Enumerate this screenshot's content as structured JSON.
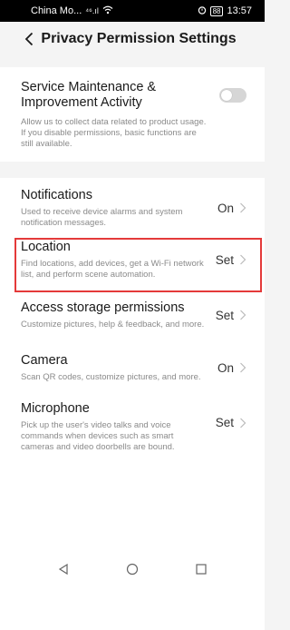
{
  "status_bar": {
    "carrier": "China Mo...",
    "signal_text": "⁴⁶.ıl",
    "time": "13:57",
    "battery": "88"
  },
  "header": {
    "title": "Privacy Permission Settings"
  },
  "service": {
    "title": "Service Maintenance & Improvement Activity",
    "desc": "Allow us to collect data related to product usage. If you disable permissions, basic functions are still available.",
    "toggle_state": "off"
  },
  "permissions": [
    {
      "title": "Notifications",
      "desc": "Used to receive device alarms and system notification messages.",
      "value": "On"
    },
    {
      "title": "Location",
      "desc": "Find locations, add devices, get a Wi-Fi network list, and perform scene automation.",
      "value": "Set"
    },
    {
      "title": "Access storage permissions",
      "desc": "Customize pictures, help & feedback, and more.",
      "value": "Set"
    },
    {
      "title": "Camera",
      "desc": "Scan QR codes, customize pictures, and more.",
      "value": "On"
    },
    {
      "title": "Microphone",
      "desc": "Pick up the user's video talks and voice commands when devices such as smart cameras and video doorbells are bound.",
      "value": "Set"
    }
  ],
  "nav": {
    "back": "back-triangle",
    "home": "home-circle",
    "recents": "recents-square"
  }
}
